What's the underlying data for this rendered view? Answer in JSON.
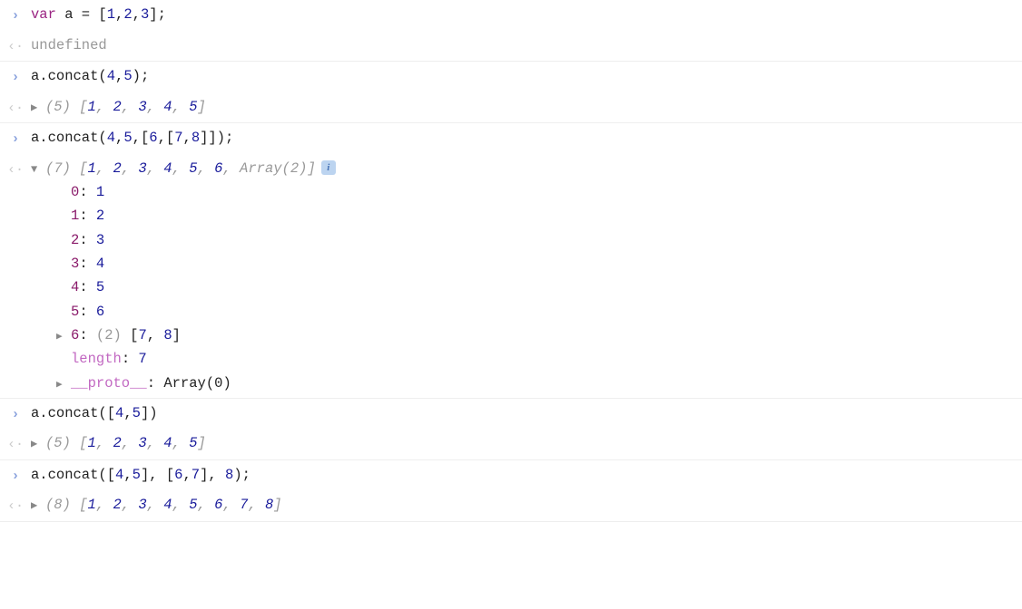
{
  "gutter": {
    "input": "›",
    "output": "‹·"
  },
  "disclosure": {
    "right": "▶",
    "down": "▼"
  },
  "rows": [
    {
      "type": "input",
      "code": {
        "kw": "var",
        "rest": " a = [",
        "n1": "1",
        "c": ",",
        "n2": "2",
        "n3": "3",
        "end": "];",
        "plain_seg1": "a = ["
      }
    },
    {
      "type": "output-plain",
      "text": "undefined"
    },
    {
      "type": "input",
      "plain": "a.concat(",
      "n1": "4",
      "c": ",",
      "n2": "5",
      "end": ");"
    },
    {
      "type": "output-array",
      "count": "(5)",
      "open": " [",
      "vals": [
        "1",
        "2",
        "3",
        "4",
        "5"
      ],
      "close": "]"
    },
    {
      "type": "input",
      "plain": "a.concat(",
      "n1": "4",
      "c": ",",
      "n2": "5",
      "seg": ",[",
      "n3": "6",
      "seg2": ",[",
      "n4": "7",
      "n5": "8",
      "end": "]]);"
    },
    {
      "type": "output-array-expanded",
      "count": "(7)",
      "open": " [",
      "vals": [
        "1",
        "2",
        "3",
        "4",
        "5",
        "6"
      ],
      "tail": "Array(2)",
      "close": "]",
      "children": [
        {
          "idx": "0",
          "val": "1"
        },
        {
          "idx": "1",
          "val": "2"
        },
        {
          "idx": "2",
          "val": "3"
        },
        {
          "idx": "3",
          "val": "4"
        },
        {
          "idx": "4",
          "val": "5"
        },
        {
          "idx": "5",
          "val": "6"
        }
      ],
      "nested": {
        "idx": "6",
        "count": "(2)",
        "open": " [",
        "v1": "7",
        "v2": "8",
        "close": "]"
      },
      "length": {
        "label": "length",
        "val": "7"
      },
      "proto": {
        "label": "__proto__",
        "val": "Array(0)"
      }
    },
    {
      "type": "input",
      "plain": "a.concat([",
      "n1": "4",
      "c": ",",
      "n2": "5",
      "end": "])"
    },
    {
      "type": "output-array",
      "count": "(5)",
      "open": " [",
      "vals": [
        "1",
        "2",
        "3",
        "4",
        "5"
      ],
      "close": "]"
    },
    {
      "type": "input",
      "plain": "a.concat([",
      "n1": "4",
      "c": ",",
      "n2": "5",
      "seg": "], [",
      "n3": "6",
      "n4": "7",
      "seg2": "], ",
      "n5": "8",
      "end": ");"
    },
    {
      "type": "output-array",
      "count": "(8)",
      "open": " [",
      "vals": [
        "1",
        "2",
        "3",
        "4",
        "5",
        "6",
        "7",
        "8"
      ],
      "close": "]"
    }
  ]
}
